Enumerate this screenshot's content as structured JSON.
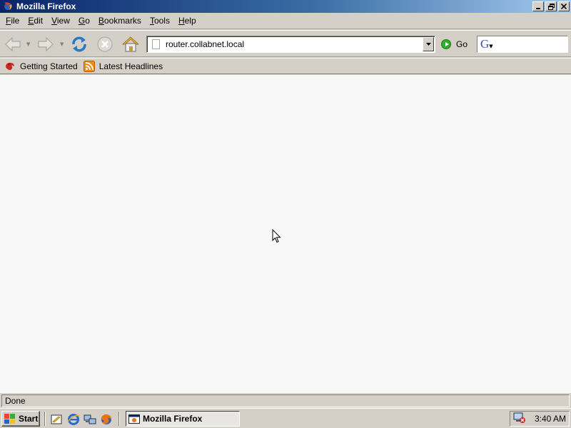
{
  "window": {
    "title": "Mozilla Firefox",
    "controls": {
      "minimize": "_",
      "maximize": "❐",
      "close": "✕"
    }
  },
  "menu": [
    {
      "label": "File",
      "accel": "F",
      "rest": "ile"
    },
    {
      "label": "Edit",
      "accel": "E",
      "rest": "dit"
    },
    {
      "label": "View",
      "accel": "V",
      "rest": "iew"
    },
    {
      "label": "Go",
      "accel": "G",
      "rest": "o"
    },
    {
      "label": "Bookmarks",
      "accel": "B",
      "rest": "ookmarks"
    },
    {
      "label": "Tools",
      "accel": "T",
      "rest": "ools"
    },
    {
      "label": "Help",
      "accel": "H",
      "rest": "elp"
    }
  ],
  "navbar": {
    "back_icon": "back-arrow-icon",
    "forward_icon": "forward-arrow-icon",
    "reload_icon": "reload-icon",
    "stop_icon": "stop-icon",
    "home_icon": "home-icon",
    "url": "router.collabnet.local",
    "go_label": "Go",
    "search_engine_icon": "G"
  },
  "bookmarks": [
    {
      "label": "Getting Started",
      "icon": "firefox-bookmark-icon"
    },
    {
      "label": "Latest Headlines",
      "icon": "rss-feed-icon"
    }
  ],
  "status": {
    "text": "Done"
  },
  "taskbar": {
    "start_label": "Start",
    "task_label": "Mozilla Firefox",
    "clock": "3:40 AM",
    "quick_launch": [
      "show-desktop-icon",
      "internet-explorer-icon",
      "network-icon",
      "firefox-icon"
    ]
  },
  "colors": {
    "titlebar_start": "#0a246a",
    "titlebar_end": "#a6caf0",
    "chrome": "#d4d0c8",
    "content_bg": "#f8f8f8"
  }
}
